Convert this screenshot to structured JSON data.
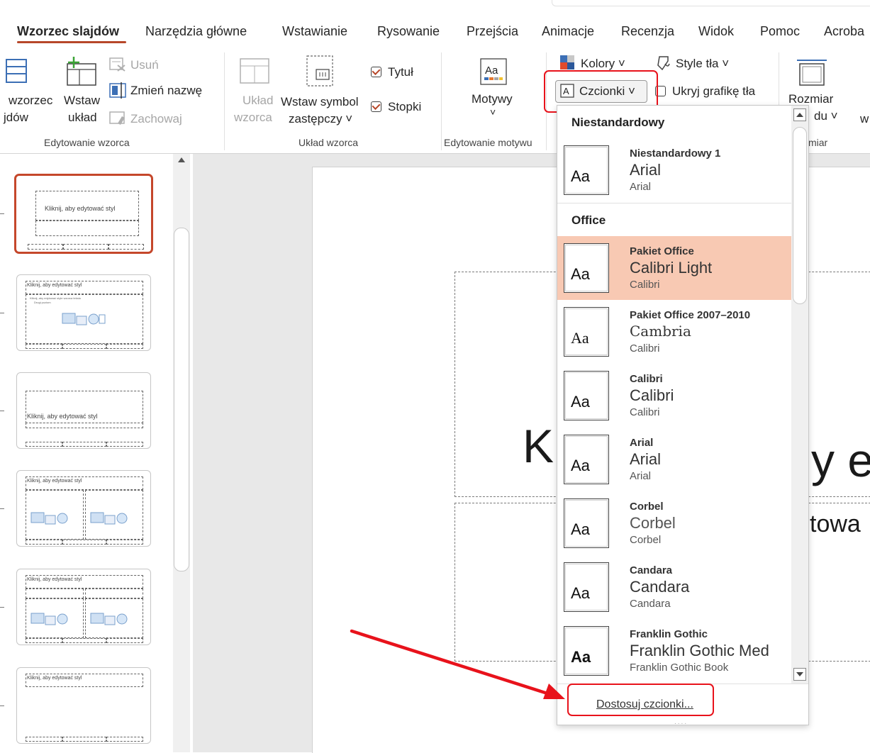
{
  "tabs": [
    "Wzorzec slajdów",
    "Narzędzia główne",
    "Wstawianie",
    "Rysowanie",
    "Przejścia",
    "Animacje",
    "Recenzja",
    "Widok",
    "Pomoc",
    "Acroba"
  ],
  "ribbon": {
    "edit_master": {
      "insert_master_l1": "wzorzec",
      "insert_master_l2": "jdów",
      "insert_layout_l1": "Wstaw",
      "insert_layout_l2": "układ",
      "delete": "Usuń",
      "rename": "Zmień nazwę",
      "preserve": "Zachowaj",
      "group": "Edytowanie wzorca"
    },
    "layout": {
      "master_layout_l1": "Układ",
      "master_layout_l2": "wzorca",
      "insert_placeholder_l1": "Wstaw symbol",
      "insert_placeholder_l2": "zastępczy ˅",
      "title": "Tytuł",
      "footers": "Stopki",
      "group": "Układ wzorca"
    },
    "theme": {
      "themes": "Motywy",
      "chevron": "˅",
      "group": "Edytowanie motywu"
    },
    "background": {
      "colors": "Kolory ˅",
      "fonts": "Czcionki ˅",
      "bg_styles": "Style tła ˅",
      "hide_graphics": "Ukryj grafikę tła",
      "group_fragment": "miar"
    },
    "size": {
      "slide_size_l1": "Rozmiar",
      "slide_size_l2": "du ˅",
      "extra": "w"
    }
  },
  "thumbnails": {
    "title_text": "Kliknij, aby edytować styl",
    "sub_bullet_1": "Kliknij, aby edytować style wzorca tekstu",
    "sub_bullet_2": "Drugi poziom"
  },
  "slide": {
    "title_fragment_left": "K",
    "title_fragment_right": "y e",
    "subtitle_fragment": "towa"
  },
  "fonts_dropdown": {
    "section_custom": "Niestandardowy",
    "section_office": "Office",
    "sample_glyph": "Aa",
    "items": [
      {
        "name": "Niestandardowy 1",
        "heading": "Arial",
        "body": "Arial"
      },
      {
        "name": "Pakiet Office",
        "heading": "Calibri Light",
        "body": "Calibri"
      },
      {
        "name": "Pakiet Office 2007–2010",
        "heading": "Cambria",
        "body": "Calibri"
      },
      {
        "name": "Calibri",
        "heading": "Calibri",
        "body": "Calibri"
      },
      {
        "name": "Arial",
        "heading": "Arial",
        "body": "Arial"
      },
      {
        "name": "Corbel",
        "heading": "Corbel",
        "body": "Corbel"
      },
      {
        "name": "Candara",
        "heading": "Candara",
        "body": "Candara"
      },
      {
        "name": "Franklin Gothic",
        "heading": "Franklin Gothic Med",
        "body": "Franklin Gothic Book"
      }
    ],
    "customize": "Dostosuj czcionki...",
    "grip": "....",
    "highlight_color": "#f8c9b3"
  },
  "colors": {
    "accent": "#b7472a",
    "annotation_red": "#e8121b"
  }
}
